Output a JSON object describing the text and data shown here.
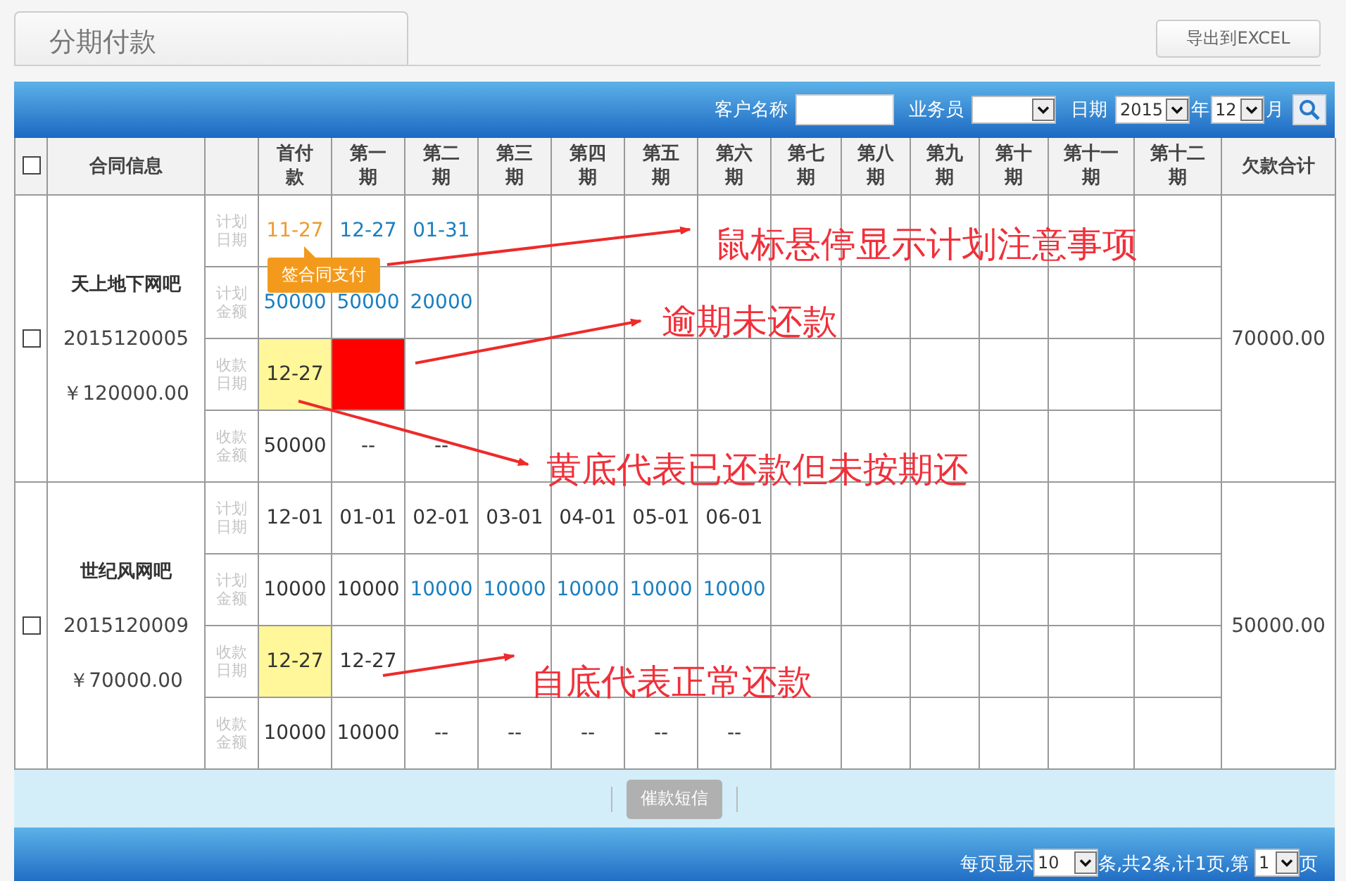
{
  "page_title": "分期付款",
  "export_button": "导出到EXCEL",
  "filters": {
    "customer_label": "客户名称",
    "salesman_label": "业务员",
    "date_label": "日期",
    "year": "2015",
    "year_unit": "年",
    "month": "12",
    "month_unit": "月"
  },
  "header": {
    "select_all_checked": false,
    "contract": "合同信息",
    "periods": [
      "首付款",
      "第一期",
      "第二期",
      "第三期",
      "第四期",
      "第五期",
      "第六期",
      "第七期",
      "第八期",
      "第九期",
      "第十期",
      "第十一期",
      "第十二期"
    ],
    "total": "欠款合计"
  },
  "contracts": [
    {
      "checked": false,
      "name": "天上地下网吧",
      "number": "2015120005",
      "amount": "￥120000.00",
      "total": "70000.00",
      "rows": [
        {
          "label": "计划日期",
          "cells": [
            {
              "text": "11-27",
              "kind": "hinted",
              "tooltip": "签合同支付"
            },
            {
              "text": "12-27",
              "kind": "upcoming"
            },
            {
              "text": "01-31",
              "kind": "upcoming"
            }
          ]
        },
        {
          "label": "计划金额",
          "cells": [
            {
              "text": "50000",
              "kind": "upcoming"
            },
            {
              "text": "50000",
              "kind": "upcoming"
            },
            {
              "text": "20000",
              "kind": "upcoming"
            }
          ]
        },
        {
          "label": "收款日期",
          "cells": [
            {
              "text": "12-27",
              "kind": "late"
            },
            {
              "kind": "overdue"
            }
          ]
        },
        {
          "label": "收款金额",
          "cells": [
            {
              "text": "50000",
              "kind": "plain"
            },
            {
              "text": "--",
              "kind": "plain"
            },
            {
              "text": "--",
              "kind": "plain"
            }
          ]
        }
      ]
    },
    {
      "checked": false,
      "name": "世纪风网吧",
      "number": "2015120009",
      "amount": "￥70000.00",
      "total": "50000.00",
      "rows": [
        {
          "label": "计划日期",
          "cells": [
            {
              "text": "12-01",
              "kind": "plain"
            },
            {
              "text": "01-01",
              "kind": "plain"
            },
            {
              "text": "02-01",
              "kind": "plain"
            },
            {
              "text": "03-01",
              "kind": "plain"
            },
            {
              "text": "04-01",
              "kind": "plain"
            },
            {
              "text": "05-01",
              "kind": "plain"
            },
            {
              "text": "06-01",
              "kind": "plain"
            }
          ]
        },
        {
          "label": "计划金额",
          "cells": [
            {
              "text": "10000",
              "kind": "plain"
            },
            {
              "text": "10000",
              "kind": "plain"
            },
            {
              "text": "10000",
              "kind": "upcoming"
            },
            {
              "text": "10000",
              "kind": "upcoming"
            },
            {
              "text": "10000",
              "kind": "upcoming"
            },
            {
              "text": "10000",
              "kind": "upcoming"
            },
            {
              "text": "10000",
              "kind": "upcoming"
            }
          ]
        },
        {
          "label": "收款日期",
          "cells": [
            {
              "text": "12-27",
              "kind": "late"
            },
            {
              "text": "12-27",
              "kind": "plain"
            }
          ]
        },
        {
          "label": "收款金额",
          "cells": [
            {
              "text": "10000",
              "kind": "plain"
            },
            {
              "text": "10000",
              "kind": "plain"
            },
            {
              "text": "--",
              "kind": "plain"
            },
            {
              "text": "--",
              "kind": "plain"
            },
            {
              "text": "--",
              "kind": "plain"
            },
            {
              "text": "--",
              "kind": "plain"
            },
            {
              "text": "--",
              "kind": "plain"
            }
          ]
        }
      ]
    }
  ],
  "remind_button": {
    "label": "催款短信",
    "disabled": true
  },
  "pager": {
    "per_page_label": "每页显示",
    "per_page": "10",
    "summary": "条,共2条,计1页,第",
    "page": "1",
    "page_unit": "页"
  },
  "annotations": [
    {
      "text": "鼠标悬停显示计划注意事项"
    },
    {
      "text": "逾期未还款"
    },
    {
      "text": "黄底代表已还款但未按期还"
    },
    {
      "text": "自底代表正常还款"
    }
  ]
}
